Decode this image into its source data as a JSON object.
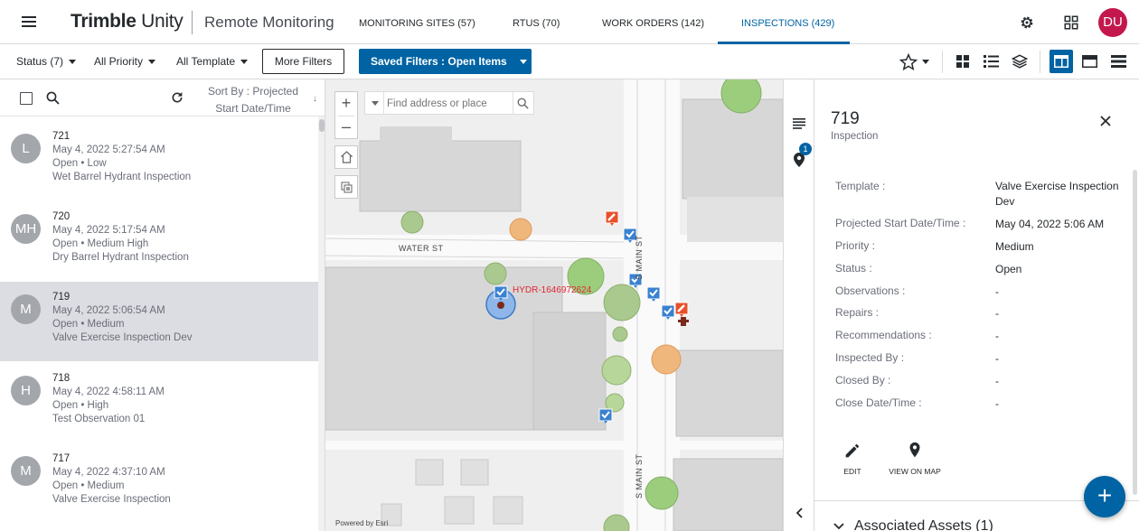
{
  "header": {
    "brand": "Trimble",
    "brand_suffix": "Unity",
    "product": "Remote Monitoring",
    "tabs": [
      {
        "label": "MONITORING SITES (57)"
      },
      {
        "label": "RTUS (70)"
      },
      {
        "label": "WORK ORDERS (142)"
      },
      {
        "label": "INSPECTIONS (429)"
      }
    ],
    "active_tab": "INSPECTIONS (429)",
    "avatar_initials": "DU",
    "avatar_color": "#c3174d",
    "icons": [
      "settings-icon",
      "apps-grid-icon"
    ]
  },
  "filters": {
    "status": "Status (7)",
    "priority": "All Priority",
    "template": "All Template",
    "more": "More Filters",
    "saved": "Saved Filters : Open Items"
  },
  "list": {
    "sort_label": "Sort By : Projected Start Date/Time",
    "items": [
      {
        "avatar": "L",
        "id": "721",
        "date": "May 4, 2022 5:27:54 AM",
        "status": "Open • Low",
        "name": "Wet Barrel Hydrant Inspection",
        "selected": false
      },
      {
        "avatar": "MH",
        "id": "720",
        "date": "May 4, 2022 5:17:54 AM",
        "status": "Open • Medium High",
        "name": "Dry Barrel Hydrant Inspection",
        "selected": false
      },
      {
        "avatar": "M",
        "id": "719",
        "date": "May 4, 2022 5:06:54 AM",
        "status": "Open • Medium",
        "name": "Valve Exercise Inspection Dev",
        "selected": true
      },
      {
        "avatar": "H",
        "id": "718",
        "date": "May 4, 2022 4:58:11 AM",
        "status": "Open • High",
        "name": "Test Observation 01",
        "selected": false
      },
      {
        "avatar": "M",
        "id": "717",
        "date": "May 4, 2022 4:37:10 AM",
        "status": "Open • Medium",
        "name": "Valve Exercise Inspection",
        "selected": false
      }
    ]
  },
  "map": {
    "search_placeholder": "Find address or place",
    "asset_label": "HYDR-1646972624",
    "street_water": "WATER ST",
    "street_main_1": "S MAIN ST",
    "street_main_2": "S MAIN ST",
    "attribution": "Powered by Esri",
    "marker_color": "#0063a3",
    "alert_color": "#e8502a"
  },
  "rail": {
    "badge": "1"
  },
  "details": {
    "title": "719",
    "subtitle": "Inspection",
    "props": [
      {
        "key": "Template :",
        "value": "Valve Exercise Inspection Dev"
      },
      {
        "key": "Projected Start Date/Time :",
        "value": "May 04, 2022 5:06 AM"
      },
      {
        "key": "Priority :",
        "value": "Medium"
      },
      {
        "key": "Status :",
        "value": "Open"
      },
      {
        "key": "Observations :",
        "value": "-"
      },
      {
        "key": "Repairs :",
        "value": "-"
      },
      {
        "key": "Recommendations :",
        "value": "-"
      },
      {
        "key": "Inspected By :",
        "value": "-"
      },
      {
        "key": "Closed By :",
        "value": "-"
      },
      {
        "key": "Close Date/Time :",
        "value": "-"
      }
    ],
    "actions": [
      {
        "label": "EDIT"
      },
      {
        "label": "VIEW ON MAP"
      }
    ],
    "section": "Associated Assets (1)"
  },
  "fab": {
    "label": "+"
  }
}
